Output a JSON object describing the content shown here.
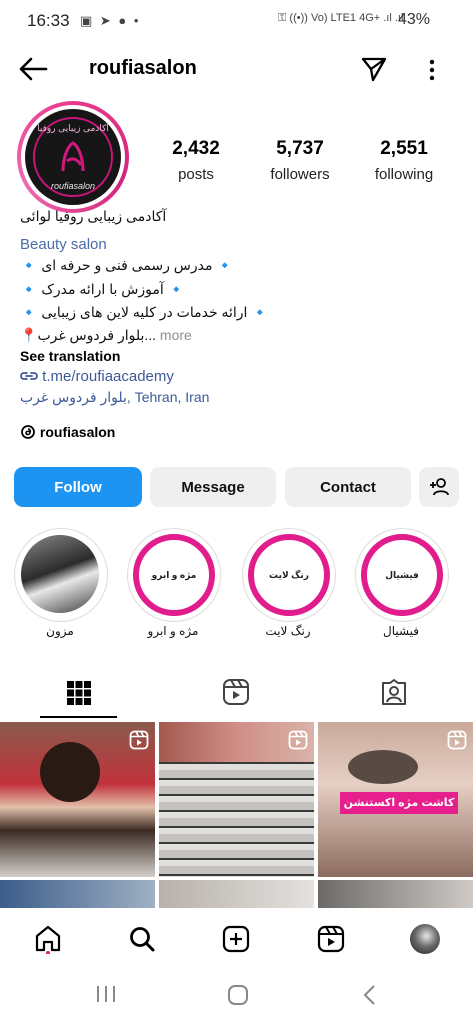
{
  "status_bar": {
    "time": "16:33",
    "left_icons": "▣ ➤ ● •",
    "right_icons": "⚿ ((•)) Vo) LTE1 4G+ .ıl .ıl",
    "battery": "43%"
  },
  "header": {
    "username": "roufiasalon",
    "back_icon": "arrow-left-icon",
    "send_icon": "paper-plane-icon",
    "more_icon": "vertical-dots-icon"
  },
  "avatar": {
    "top_text": "آکادمی زیبایی روفیا",
    "bottom_text": "roufiasalon"
  },
  "stats": {
    "posts_count": "2,432",
    "posts_label": "posts",
    "followers_count": "5,737",
    "followers_label": "followers",
    "following_count": "2,551",
    "following_label": "following"
  },
  "bio": {
    "name": "آکادمی زیبایی روفیا لوائی",
    "category": "Beauty salon",
    "line1": "🔹 مدرس رسمی فنی و حرفه ای 🔹",
    "line2": "🔹 آموزش با ارائه مدرک 🔹",
    "line3": "🔹 ارائه خدمات در کلیه لاین های زیبایی 🔹",
    "line4": "📍بلوار فردوس غرب...",
    "more": " more",
    "see_translation": "See translation",
    "link": "t.me/roufiaacademy",
    "address": "بلوار فردوس غرب, Tehran, Iran",
    "threads": "roufiasalon"
  },
  "actions": {
    "follow": "Follow",
    "message": "Message",
    "contact": "Contact",
    "add_user_icon": "add-user-icon"
  },
  "highlights": [
    {
      "label": "مزون",
      "cover_text": ""
    },
    {
      "label": "مژه و ابرو",
      "cover_text": "مژه و ابرو"
    },
    {
      "label": "رنگ لایت",
      "cover_text": "رنگ لایت"
    },
    {
      "label": "فیشیال",
      "cover_text": "فیشیال"
    }
  ],
  "tabs": [
    "grid-icon",
    "reels-icon",
    "tagged-icon"
  ],
  "grid": {
    "tile3_text": "کاشت مژه اکستنشن",
    "reel_icon": "reel-icon"
  },
  "bottom_nav": [
    "home-icon",
    "search-icon",
    "create-icon",
    "reels-icon",
    "profile-avatar-icon"
  ],
  "system_nav": [
    "recents-icon",
    "home-button-icon",
    "back-icon"
  ],
  "colors": {
    "accent": "#1d94f2",
    "link": "#3d5a98",
    "highlight_ring": "#e11d8e",
    "story_ring": "#e83a8b"
  }
}
